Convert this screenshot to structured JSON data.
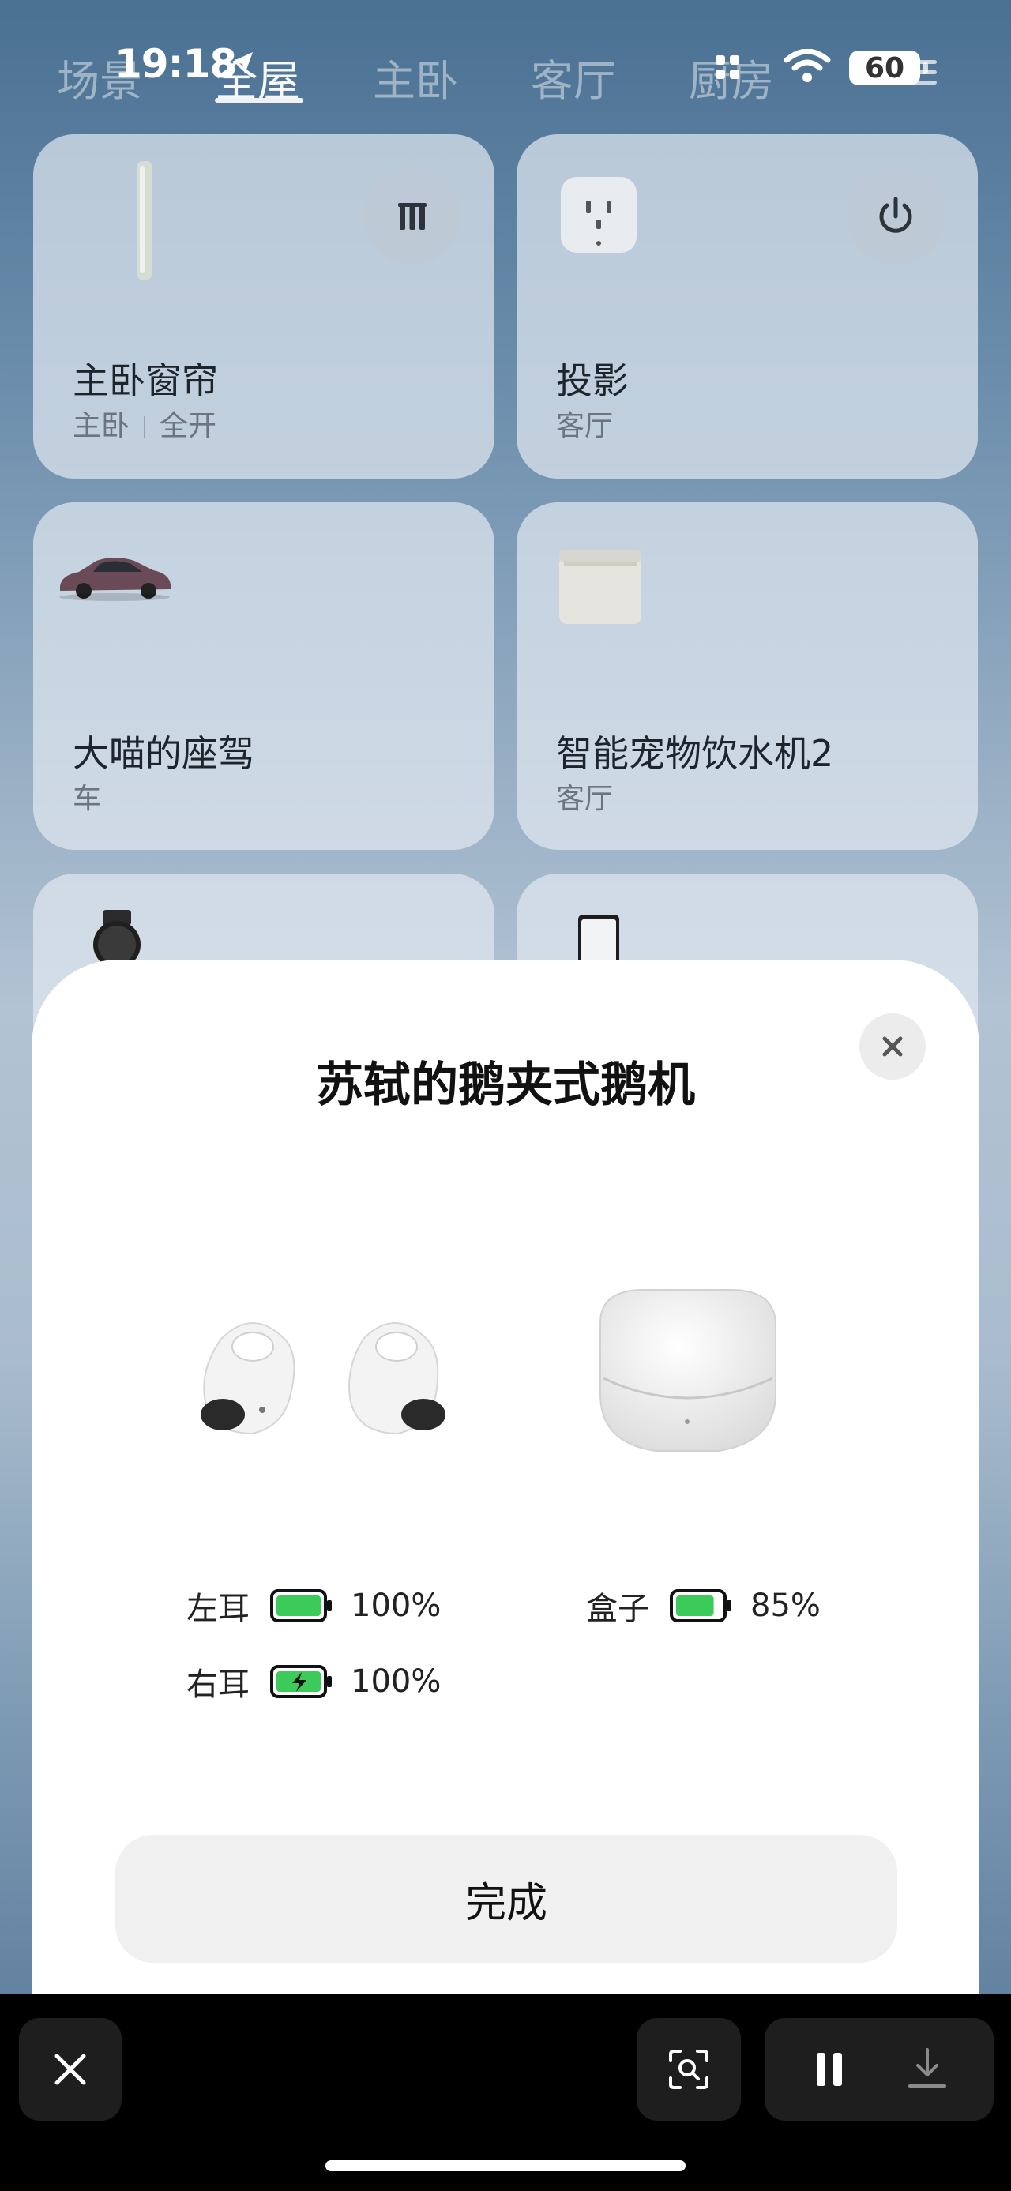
{
  "status_bar": {
    "time": "19:18",
    "battery": "60"
  },
  "room_tabs": [
    "场景",
    "全屋",
    "主卧",
    "客厅",
    "厨房"
  ],
  "active_tab": "全屋",
  "devices": [
    {
      "name": "主卧窗帘",
      "room": "主卧",
      "status": "全开",
      "icon": "curtain-icon",
      "action_icon": "pause-icon"
    },
    {
      "name": "投影",
      "room": "客厅",
      "icon": "socket-icon",
      "action_icon": "power-icon"
    },
    {
      "name": "大喵的座驾",
      "room": "车",
      "icon": "car-image"
    },
    {
      "name": "智能宠物饮水机2",
      "room": "客厅",
      "icon": "water-dispenser-image"
    },
    {
      "icon": "watch-image"
    },
    {
      "icon": "phone-image"
    }
  ],
  "sheet": {
    "title": "苏轼的鹅夹式鹅机",
    "left_label": "左耳",
    "left_value": "100%",
    "right_label": "右耳",
    "right_value": "100%",
    "case_label": "盒子",
    "case_value": "85%",
    "left_level": 1.0,
    "right_level": 1.0,
    "case_level": 0.85,
    "right_charging": true,
    "done_label": "完成"
  },
  "colors": {
    "battery_green": "#3ccb5a",
    "sheet_bg": "#ffffff",
    "bottom_bar": "#000000"
  }
}
